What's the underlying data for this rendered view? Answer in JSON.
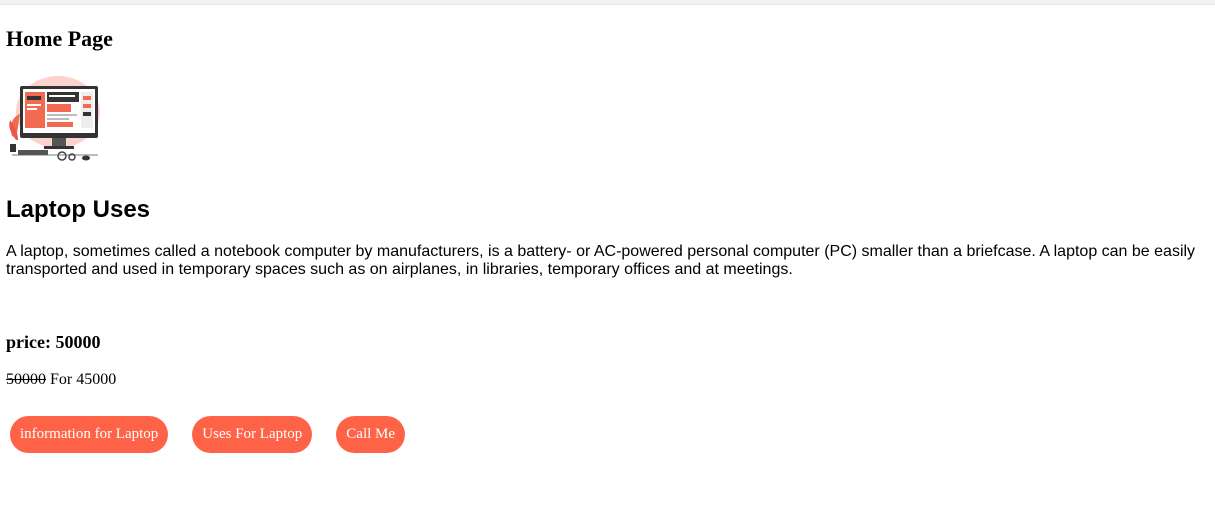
{
  "header": {
    "title": "Home Page"
  },
  "hero": {
    "image": "computer-desk-illustration"
  },
  "article": {
    "title": "Laptop Uses",
    "description": "A laptop, sometimes called a notebook computer by manufacturers, is a battery- or AC-powered personal computer (PC) smaller than a briefcase. A laptop can be easily transported and used in temporary spaces such as on airplanes, in libraries, temporary offices and at meetings."
  },
  "pricing": {
    "price_label": "price: 50000",
    "old_price": "50000",
    "offer_text": " For 45000"
  },
  "buttons": [
    {
      "label": "information for Laptop"
    },
    {
      "label": "Uses For Laptop"
    },
    {
      "label": "Call Me"
    }
  ],
  "colors": {
    "accent": "#ff6347"
  }
}
